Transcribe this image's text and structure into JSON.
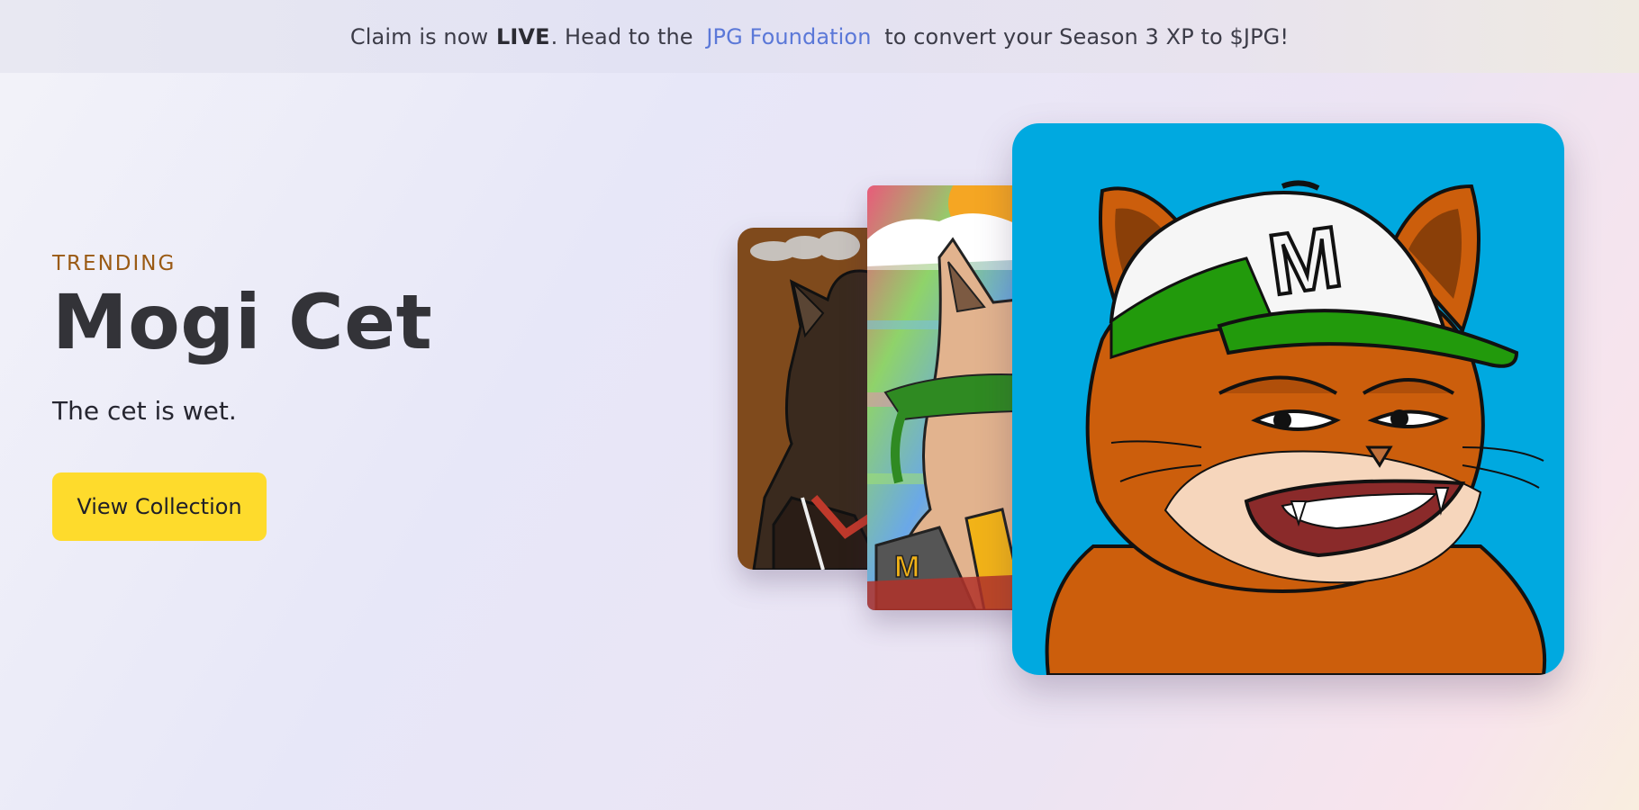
{
  "announcement": {
    "prefix": "Claim is now ",
    "highlight": "LIVE",
    "middle": ". Head to the ",
    "link_text": "JPG Foundation",
    "suffix": " to convert your Season 3 XP to $JPG!"
  },
  "hero": {
    "eyebrow": "TRENDING",
    "title": "Mogi Cet",
    "description": "The cet is wet.",
    "cta_label": "View Collection"
  },
  "gallery": {
    "cards": [
      {
        "name": "nft-card-dark-cat",
        "background": "#7f4a1c"
      },
      {
        "name": "nft-card-glitch-cat",
        "background": "#8aa8c8"
      },
      {
        "name": "nft-card-mogi-cet",
        "background": "#00a9e0"
      }
    ]
  },
  "colors": {
    "accent": "#fedb2c",
    "link": "#5b78d8",
    "eyebrow": "#9a5a14"
  }
}
